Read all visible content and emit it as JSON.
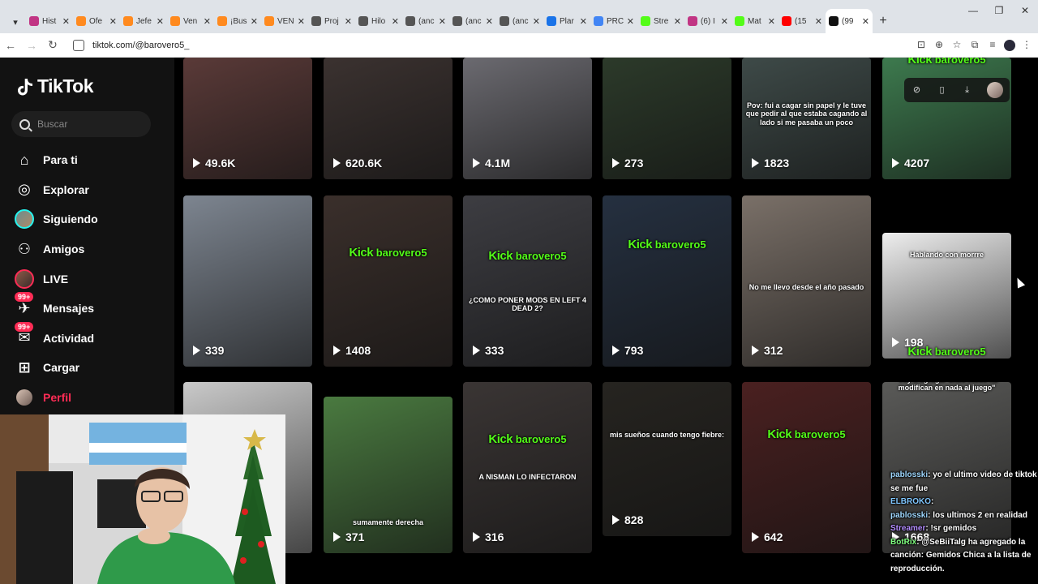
{
  "browser": {
    "tabs": [
      {
        "label": "Hist",
        "color": "#c13584",
        "icon": "instagram-icon"
      },
      {
        "label": "Ofe",
        "color": "#ff8a1f",
        "icon": "globe-icon"
      },
      {
        "label": "Jefe",
        "color": "#ff8a1f",
        "icon": "globe-icon"
      },
      {
        "label": "Ven",
        "color": "#ff8a1f",
        "icon": "globe-icon"
      },
      {
        "label": "¡Bus",
        "color": "#ff8a1f",
        "icon": "globe-icon"
      },
      {
        "label": "VEN",
        "color": "#ff8a1f",
        "icon": "globe-icon"
      },
      {
        "label": "Proj",
        "color": "#555555",
        "icon": "project-icon"
      },
      {
        "label": "Hilo",
        "color": "#555555",
        "icon": "thread-icon"
      },
      {
        "label": "(anc",
        "color": "#555555",
        "icon": "globe-icon"
      },
      {
        "label": "(anc",
        "color": "#555555",
        "icon": "globe-icon"
      },
      {
        "label": "(anc",
        "color": "#555555",
        "icon": "globe-icon"
      },
      {
        "label": "Plar",
        "color": "#1a73e8",
        "icon": "compass-icon"
      },
      {
        "label": "PRC",
        "color": "#4285f4",
        "icon": "doc-icon"
      },
      {
        "label": "Stre",
        "color": "#53fc18",
        "icon": "kick-icon"
      },
      {
        "label": "(6) I",
        "color": "#c13584",
        "icon": "instagram-icon"
      },
      {
        "label": "Mat",
        "color": "#53fc18",
        "icon": "kick-icon"
      },
      {
        "label": "(15",
        "color": "#ff0000",
        "icon": "youtube-icon"
      },
      {
        "label": "(99",
        "color": "#111111",
        "icon": "tiktok-icon",
        "active": true
      }
    ],
    "url": "tiktok.com/@barovero5_"
  },
  "sidebar": {
    "brand": "TikTok",
    "search_placeholder": "Buscar",
    "items": [
      {
        "label": "Para ti",
        "icon": "home-icon"
      },
      {
        "label": "Explorar",
        "icon": "compass-icon"
      },
      {
        "label": "Siguiendo",
        "icon": "following-avatar-icon"
      },
      {
        "label": "Amigos",
        "icon": "friends-icon"
      },
      {
        "label": "LIVE",
        "icon": "live-avatar-icon"
      },
      {
        "label": "Mensajes",
        "icon": "messages-icon",
        "badge": "99+"
      },
      {
        "label": "Actividad",
        "icon": "activity-icon",
        "badge": "99+"
      },
      {
        "label": "Cargar",
        "icon": "upload-icon"
      },
      {
        "label": "Perfil",
        "icon": "profile-avatar-icon",
        "active": true
      }
    ]
  },
  "videos": [
    {
      "views": "49.6K",
      "bg": "#5a3a38"
    },
    {
      "views": "620.6K",
      "bg": "#3b3230"
    },
    {
      "views": "4.1M",
      "bg": "#6b6a70"
    },
    {
      "views": "273",
      "bg": "#2c3a2a"
    },
    {
      "views": "1823",
      "bg": "#3e4a48",
      "overlay": "Pov: fui a cagar sin papel y le tuve que pedir al que estaba cagando al lado si me pasaba un poco"
    },
    {
      "views": "4207",
      "bg": "#3d7a4e",
      "kick": "barovero5"
    },
    {
      "views": "339",
      "bg": "#7d8590"
    },
    {
      "views": "1408",
      "bg": "#3a2f2b",
      "kick": "barovero5"
    },
    {
      "views": "333",
      "bg": "#3d3d42",
      "kick": "barovero5",
      "overlay": "¿COMO PONER MODS EN LEFT 4 DEAD 2?"
    },
    {
      "views": "793",
      "bg": "#253040",
      "kick": "barovero5"
    },
    {
      "views": "312",
      "bg": "#7a7068",
      "overlay": "No me llevo desde el año pasado"
    },
    {
      "views": "198",
      "bg": "#eeeeee",
      "kick": "barovero5",
      "overlay": "Hablando con morrre"
    },
    {
      "views": "",
      "bg": "#c9c9c9"
    },
    {
      "views": "371",
      "bg": "#4a7a40",
      "overlay": "sumamente derecha"
    },
    {
      "views": "316",
      "bg": "#3a3534",
      "kick": "barovero5",
      "overlay": "A NISMAN LO INFECTARON"
    },
    {
      "views": "828",
      "bg": "#262420",
      "overlay": "mis sueños cuando tengo fiebre:"
    },
    {
      "views": "642",
      "bg": "#4a2020",
      "kick": "barovero5"
    },
    {
      "views": "1668",
      "bg": "#5a5a58",
      "overlay": "\"voy a agregar unos mods no modifican en nada al juego\""
    }
  ],
  "chat": [
    {
      "user": "pablosski",
      "text": ": yo el ultimo video de tiktok se me fue",
      "cls": "user"
    },
    {
      "user": "ELBROKO",
      "text": ":",
      "cls": "u2"
    },
    {
      "user": "pablosski",
      "text": ": los ultimos 2 en realidad",
      "cls": "user"
    },
    {
      "user": "Streamer",
      "text": ": !sr gemidos",
      "cls": "u3"
    },
    {
      "user": "BotRix",
      "text": ": @SeBiiTalg ha agregado la canción: Gemidos Chica a la lista de reproducción.",
      "cls": "bot"
    }
  ]
}
